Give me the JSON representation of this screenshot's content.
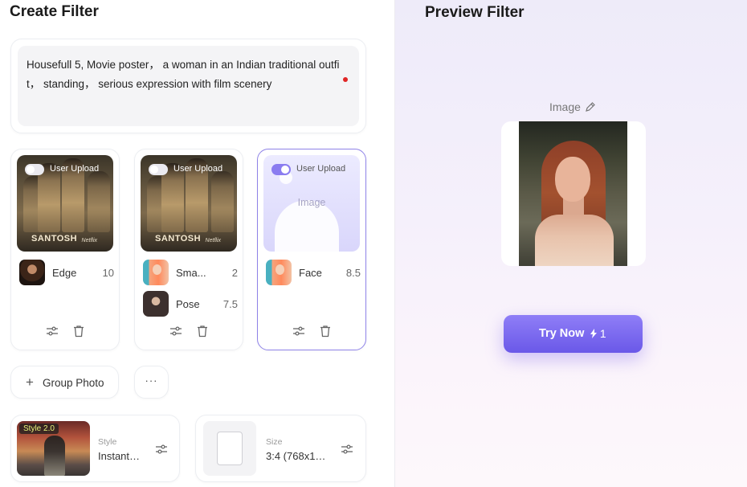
{
  "left_panel": {
    "title": "Create Filter",
    "prompt": {
      "text": "Housefull 5, Movie poster， a woman in an Indian traditional outfit， standing， serious expression with film scenery"
    },
    "reference_cards": [
      {
        "toggle_label": "User Upload",
        "toggle_on": false,
        "poster_title": "SANTOSH",
        "poster_badge": "Netflix",
        "items": [
          {
            "label": "Edge",
            "value": "10"
          }
        ]
      },
      {
        "toggle_label": "User Upload",
        "toggle_on": false,
        "poster_title": "SANTOSH",
        "poster_badge": "Netflix",
        "items": [
          {
            "label": "Sma...",
            "value": "2"
          },
          {
            "label": "Pose",
            "value": "7.5"
          }
        ]
      },
      {
        "toggle_label": "User Upload",
        "toggle_on": true,
        "placeholder": "Image",
        "items": [
          {
            "label": "Face",
            "value": "8.5"
          }
        ]
      }
    ],
    "group_photo_button": "Group Photo",
    "more_button": "···",
    "style_card": {
      "badge": "Style 2.0",
      "label": "Style",
      "value": "Instant…"
    },
    "size_card": {
      "label": "Size",
      "value": "3:4 (768x1…"
    }
  },
  "right_panel": {
    "title": "Preview Filter",
    "image_label": "Image",
    "try_button": {
      "label": "Try Now",
      "cost": "1"
    }
  },
  "colors": {
    "accent": "#7b6cf0",
    "selected_border": "#8f83e8",
    "toggle_on": "#8a7cf0",
    "warning_dot": "#e02525"
  },
  "icons": {
    "adjust": "sliders-icon",
    "delete": "trash-icon",
    "edit": "pencil-icon",
    "add": "plus-icon",
    "more": "ellipsis-icon",
    "cost": "lightning-icon"
  }
}
